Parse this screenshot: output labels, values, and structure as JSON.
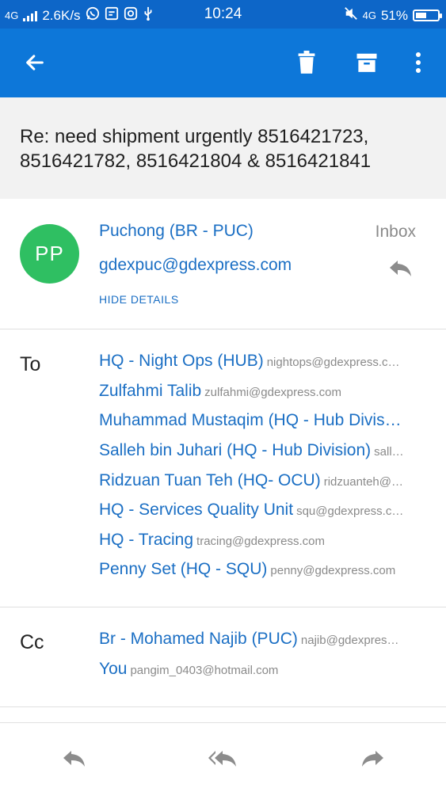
{
  "status_bar": {
    "network_left": "4G",
    "speed": "2.6K/s",
    "time": "10:24",
    "network_right": "4G",
    "battery": "51%",
    "battery_level": 0.51
  },
  "toolbar": {
    "back_icon": "arrow-left-icon",
    "delete_icon": "trash-icon",
    "archive_icon": "archive-icon",
    "more_icon": "more-vertical-icon"
  },
  "message": {
    "subject": "Re: need shipment urgently 8516421723, 8516421782, 8516421804 & 8516421841",
    "avatar_initials": "PP",
    "sender_name": "Puchong (BR - PUC)",
    "sender_email": "gdexpuc@gdexpress.com",
    "folder": "Inbox",
    "hide_details": "HIDE DETAILS"
  },
  "to": {
    "label": "To",
    "recipients": [
      {
        "name": "HQ - Night Ops (HUB)",
        "email": "nightops@gdexpress.c…"
      },
      {
        "name": "Zulfahmi Talib",
        "email": "zulfahmi@gdexpress.com"
      },
      {
        "name": "Muhammad Mustaqim (HQ - Hub Divis…",
        "email": ""
      },
      {
        "name": "Salleh bin Juhari (HQ - Hub Division)",
        "email": "sall…"
      },
      {
        "name": "Ridzuan Tuan Teh (HQ- OCU)",
        "email": "ridzuanteh@…"
      },
      {
        "name": "HQ - Services Quality Unit",
        "email": "squ@gdexpress.c…"
      },
      {
        "name": "HQ - Tracing",
        "email": "tracing@gdexpress.com"
      },
      {
        "name": "Penny Set (HQ - SQU)",
        "email": "penny@gdexpress.com"
      }
    ]
  },
  "cc": {
    "label": "Cc",
    "recipients": [
      {
        "name": "Br - Mohamed Najib (PUC)",
        "email": "najib@gdexpres…"
      },
      {
        "name": "You",
        "email": "pangim_0403@hotmail.com"
      }
    ]
  },
  "bottom_actions": {
    "reply_icon": "reply-icon",
    "reply_all_icon": "reply-all-icon",
    "forward_icon": "forward-icon"
  },
  "colors": {
    "appbar": "#0d77d9",
    "statusbar": "#0d66c8",
    "link": "#1b6fc4",
    "avatar": "#2fbf62"
  }
}
